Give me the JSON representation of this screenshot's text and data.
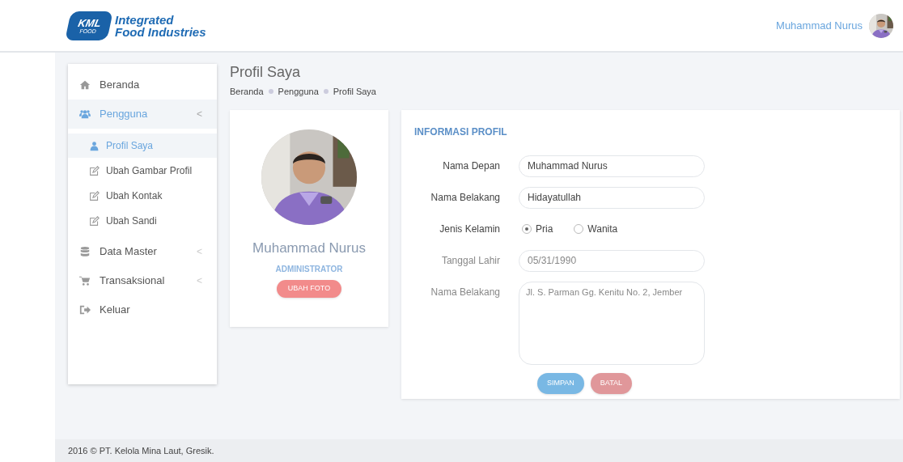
{
  "header": {
    "brand_logo": "KML",
    "brand_logo_sub": "FOOD",
    "brand_line1": "Integrated",
    "brand_line2": "Food Industries",
    "user_name": "Muhammad Nurus"
  },
  "sidebar": {
    "items": [
      {
        "label": "Beranda",
        "selected": false
      },
      {
        "label": "Pengguna",
        "selected": true,
        "expanded": true,
        "chevron": "<",
        "children": [
          {
            "label": "Profil Saya",
            "selected": true
          },
          {
            "label": "Ubah Gambar Profil",
            "selected": false
          },
          {
            "label": "Ubah Kontak",
            "selected": false
          },
          {
            "label": "Ubah Sandi",
            "selected": false
          }
        ]
      },
      {
        "label": "Data Master",
        "selected": false,
        "expanded": false,
        "chevron": "<"
      },
      {
        "label": "Transaksional",
        "selected": false,
        "expanded": false,
        "chevron": "<"
      },
      {
        "label": "Keluar",
        "selected": false
      }
    ]
  },
  "page": {
    "title": "Profil Saya",
    "breadcrumb": [
      "Beranda",
      "Pengguna",
      "Profil Saya"
    ]
  },
  "profile_card": {
    "name": "Muhammad Nurus",
    "role": "ADMINISTRATOR",
    "button": "UBAH FOTO"
  },
  "info_card": {
    "title": "INFORMASI PROFIL",
    "fields": [
      {
        "kind": "text",
        "label": "Nama Depan",
        "value": "Muhammad Nurus",
        "disabled": false
      },
      {
        "kind": "text",
        "label": "Nama Belakang",
        "value": "Hidayatullah",
        "disabled": false
      },
      {
        "kind": "radio",
        "label": "Jenis Kelamin",
        "options": [
          {
            "label": "Pria",
            "selected": true
          },
          {
            "label": "Wanita",
            "selected": false
          }
        ]
      },
      {
        "kind": "text",
        "label": "Tanggal Lahir",
        "value": "05/31/1990",
        "disabled": true
      },
      {
        "kind": "textarea",
        "label": "Nama Belakang",
        "value": "Jl. S. Parman Gg. Kenitu No. 2, Jember",
        "disabled": true
      }
    ],
    "buttons": [
      {
        "label": "SIMPAN",
        "kind": "primary"
      },
      {
        "label": "BATAL",
        "kind": "danger"
      }
    ]
  },
  "footer": "2016 © PT. Kelola Mina Laut, Gresik."
}
